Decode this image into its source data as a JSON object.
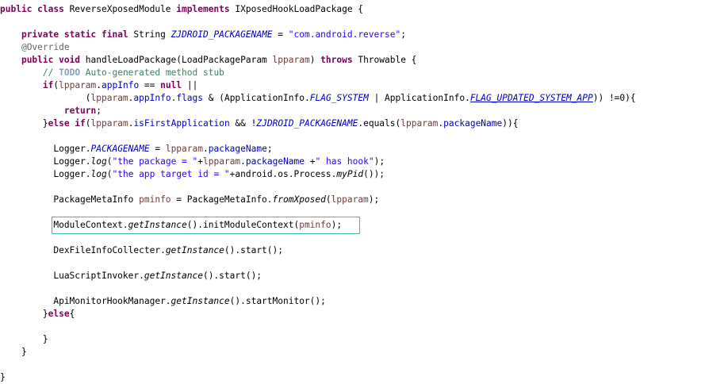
{
  "colors": {
    "keyword": "#7f0055",
    "string": "#2a00ff",
    "field": "#0000c0",
    "comment": "#3f7f5f",
    "todo": "#7f9fbf",
    "annotation": "#646464",
    "local_variable": "#6a3e3e",
    "highlight_border": "#3fb8b8"
  },
  "code": {
    "lines": [
      {
        "tokens": [
          {
            "t": "public class",
            "c": "kw"
          },
          {
            "t": " ReverseXposedModule "
          },
          {
            "t": "implements",
            "c": "kw"
          },
          {
            "t": " IXposedHookLoadPackage {"
          }
        ]
      },
      {
        "tokens": []
      },
      {
        "tokens": [
          {
            "t": "    "
          },
          {
            "t": "private static final",
            "c": "kw"
          },
          {
            "t": " String "
          },
          {
            "t": "ZJDROID_PACKAGENAME",
            "c": "sf"
          },
          {
            "t": " = "
          },
          {
            "t": "\"com.android.reverse\"",
            "c": "str"
          },
          {
            "t": ";"
          }
        ]
      },
      {
        "tokens": [
          {
            "t": "    "
          },
          {
            "t": "@Override",
            "c": "ann"
          }
        ]
      },
      {
        "tokens": [
          {
            "t": "    "
          },
          {
            "t": "public void",
            "c": "kw"
          },
          {
            "t": " handleLoadPackage(LoadPackageParam "
          },
          {
            "t": "lpparam",
            "c": "loc"
          },
          {
            "t": ") "
          },
          {
            "t": "throws",
            "c": "kw"
          },
          {
            "t": " Throwable {"
          }
        ]
      },
      {
        "tokens": [
          {
            "t": "        "
          },
          {
            "t": "// ",
            "c": "cm"
          },
          {
            "t": "TODO",
            "c": "todo"
          },
          {
            "t": " Auto-generated method stub",
            "c": "cm"
          }
        ]
      },
      {
        "tokens": [
          {
            "t": "        "
          },
          {
            "t": "if",
            "c": "kw"
          },
          {
            "t": "("
          },
          {
            "t": "lpparam",
            "c": "loc"
          },
          {
            "t": "."
          },
          {
            "t": "appInfo",
            "c": "fld"
          },
          {
            "t": " == "
          },
          {
            "t": "null",
            "c": "kw"
          },
          {
            "t": " ||"
          }
        ]
      },
      {
        "tokens": [
          {
            "t": "                ("
          },
          {
            "t": "lpparam",
            "c": "loc"
          },
          {
            "t": "."
          },
          {
            "t": "appInfo",
            "c": "fld"
          },
          {
            "t": "."
          },
          {
            "t": "flags",
            "c": "fld"
          },
          {
            "t": " & (ApplicationInfo."
          },
          {
            "t": "FLAG_SYSTEM",
            "c": "sf"
          },
          {
            "t": " | ApplicationInfo."
          },
          {
            "t": "FLAG_UPDATED_SYSTEM_APP",
            "c": "sf u"
          },
          {
            "t": ")) !=0){"
          }
        ]
      },
      {
        "tokens": [
          {
            "t": "            "
          },
          {
            "t": "return",
            "c": "kw"
          },
          {
            "t": ";"
          }
        ]
      },
      {
        "tokens": [
          {
            "t": "        }"
          },
          {
            "t": "else if",
            "c": "kw"
          },
          {
            "t": "("
          },
          {
            "t": "lpparam",
            "c": "loc"
          },
          {
            "t": "."
          },
          {
            "t": "isFirstApplication",
            "c": "fld"
          },
          {
            "t": " && !"
          },
          {
            "t": "ZJDROID_PACKAGENAME",
            "c": "sf"
          },
          {
            "t": ".equals("
          },
          {
            "t": "lpparam",
            "c": "loc"
          },
          {
            "t": "."
          },
          {
            "t": "packageName",
            "c": "fld"
          },
          {
            "t": ")){"
          }
        ]
      },
      {
        "tokens": []
      },
      {
        "tokens": [
          {
            "t": "          Logger."
          },
          {
            "t": "PACKAGENAME",
            "c": "sf"
          },
          {
            "t": " = "
          },
          {
            "t": "lpparam",
            "c": "loc"
          },
          {
            "t": "."
          },
          {
            "t": "packageName",
            "c": "fld"
          },
          {
            "t": ";"
          }
        ]
      },
      {
        "tokens": [
          {
            "t": "          Logger."
          },
          {
            "t": "log",
            "c": "sm"
          },
          {
            "t": "("
          },
          {
            "t": "\"the package = \"",
            "c": "str"
          },
          {
            "t": "+"
          },
          {
            "t": "lpparam",
            "c": "loc"
          },
          {
            "t": "."
          },
          {
            "t": "packageName",
            "c": "fld"
          },
          {
            "t": " +"
          },
          {
            "t": "\" has hook\"",
            "c": "str"
          },
          {
            "t": ");"
          }
        ]
      },
      {
        "tokens": [
          {
            "t": "          Logger."
          },
          {
            "t": "log",
            "c": "sm"
          },
          {
            "t": "("
          },
          {
            "t": "\"the app target id = \"",
            "c": "str"
          },
          {
            "t": "+android.os.Process."
          },
          {
            "t": "myPid",
            "c": "sm"
          },
          {
            "t": "());"
          }
        ]
      },
      {
        "tokens": []
      },
      {
        "tokens": [
          {
            "t": "          PackageMetaInfo "
          },
          {
            "t": "pminfo",
            "c": "loc"
          },
          {
            "t": " = PackageMetaInfo."
          },
          {
            "t": "fromXposed",
            "c": "sm"
          },
          {
            "t": "("
          },
          {
            "t": "lpparam",
            "c": "loc"
          },
          {
            "t": ");"
          }
        ]
      },
      {
        "tokens": []
      },
      {
        "tokens": [
          {
            "t": "          ModuleContext."
          },
          {
            "t": "getInstance",
            "c": "sm"
          },
          {
            "t": "().initModuleContext("
          },
          {
            "t": "pminfo",
            "c": "loc"
          },
          {
            "t": ");"
          }
        ]
      },
      {
        "tokens": []
      },
      {
        "tokens": [
          {
            "t": "          DexFileInfoCollecter."
          },
          {
            "t": "getInstance",
            "c": "sm"
          },
          {
            "t": "().start();"
          }
        ]
      },
      {
        "tokens": []
      },
      {
        "tokens": [
          {
            "t": "          LuaScriptInvoker."
          },
          {
            "t": "getInstance",
            "c": "sm"
          },
          {
            "t": "().start();"
          }
        ]
      },
      {
        "tokens": []
      },
      {
        "tokens": [
          {
            "t": "          ApiMonitorHookManager."
          },
          {
            "t": "getInstance",
            "c": "sm"
          },
          {
            "t": "().startMonitor();"
          }
        ]
      },
      {
        "tokens": [
          {
            "t": "        }"
          },
          {
            "t": "else",
            "c": "kw"
          },
          {
            "t": "{"
          }
        ]
      },
      {
        "tokens": []
      },
      {
        "tokens": [
          {
            "t": "        }"
          }
        ]
      },
      {
        "tokens": [
          {
            "t": "    }"
          }
        ]
      },
      {
        "tokens": []
      },
      {
        "tokens": [
          {
            "t": "}"
          }
        ]
      }
    ]
  }
}
